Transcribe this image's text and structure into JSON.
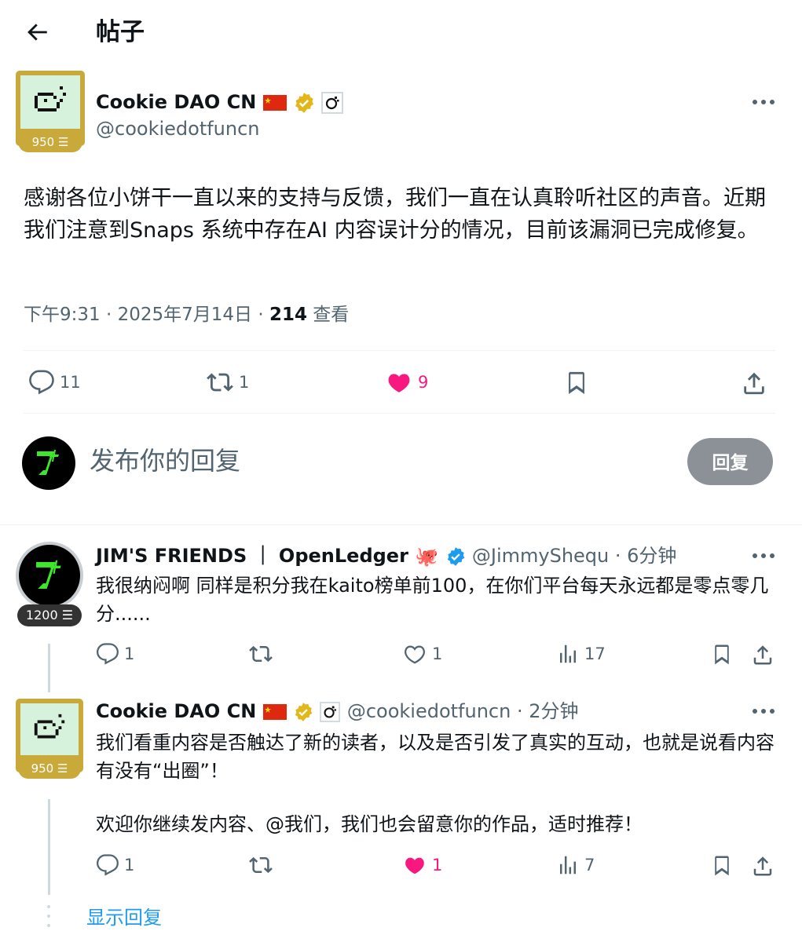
{
  "header": {
    "title": "帖子"
  },
  "post": {
    "author_name": "Cookie DAO CN",
    "author_handle": "@cookiedotfuncn",
    "score": "950",
    "text": "感谢各位小饼干一直以来的支持与反馈，我们一直在认真聆听社区的声音。近期我们注意到Snaps 系统中存在AI 内容误计分的情况，目前该漏洞已完成修复。",
    "time": "下午9:31 · 2025年7月14日 · ",
    "views": "214",
    "views_label": " 查看",
    "replies": "11",
    "reposts": "1",
    "likes": "9"
  },
  "compose": {
    "placeholder": "发布你的回复",
    "button": "回复"
  },
  "replies": [
    {
      "name": "JIM'S FRIENDS ｜ OpenLedger",
      "handle": "@JimmyShequ · 6分钟",
      "score": "1200",
      "text": "我很纳闷啊 同样是积分我在kaito榜单前100，在你们平台每天永远都是零点零几分......",
      "replies": "1",
      "reposts": "",
      "likes": "1",
      "views": "17"
    },
    {
      "name": "Cookie DAO CN",
      "handle": "@cookiedotfuncn · 2分钟",
      "score": "950",
      "text1": "我们看重内容是否触达了新的读者，以及是否引发了真实的互动，也就是说看内容有没有“出圈”！",
      "text2": "欢迎你继续发内容、@我们，我们也会留意你的作品，适时推荐！",
      "replies": "1",
      "reposts": "",
      "likes": "1",
      "views": "7"
    }
  ],
  "show_replies": "显示回复",
  "colors": {
    "like": "#f91880",
    "verified_gold": "#e2b719",
    "verified_blue": "#1d9bf0",
    "link": "#1d9bf0"
  }
}
